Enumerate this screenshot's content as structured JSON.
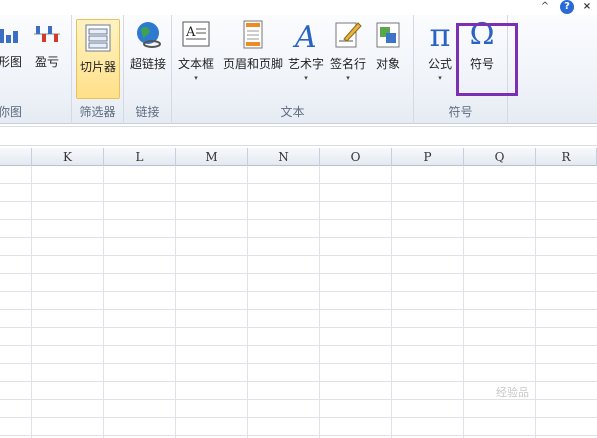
{
  "ribbon": {
    "groups": [
      {
        "label": "你图",
        "buttons": [
          {
            "label": "形图",
            "icon": "bar-sparkline-icon"
          },
          {
            "label": "盈亏",
            "icon": "winloss-sparkline-icon"
          }
        ]
      },
      {
        "label": "筛选器",
        "buttons": [
          {
            "label": "切片器",
            "icon": "slicer-icon"
          }
        ]
      },
      {
        "label": "链接",
        "buttons": [
          {
            "label": "超链接",
            "icon": "hyperlink-globe-icon"
          }
        ]
      },
      {
        "label": "文本",
        "buttons": [
          {
            "label": "文本框",
            "icon": "textbox-icon",
            "dropdown": "▾"
          },
          {
            "label": "页眉和页脚",
            "icon": "header-footer-icon"
          },
          {
            "label": "艺术字",
            "icon": "wordart-icon",
            "dropdown": "▾"
          },
          {
            "label": "签名行",
            "icon": "signature-line-icon",
            "dropdown": "▾"
          },
          {
            "label": "对象",
            "icon": "object-icon"
          }
        ]
      },
      {
        "label": "符号",
        "buttons": [
          {
            "label": "公式",
            "icon": "pi-equation-icon",
            "glyph": "π",
            "dropdown": "▾"
          },
          {
            "label": "符号",
            "icon": "omega-symbol-icon",
            "glyph": "Ω"
          }
        ]
      }
    ]
  },
  "window_controls": {
    "collapse": "^",
    "help": "?",
    "close": "×"
  },
  "columns": [
    "K",
    "L",
    "M",
    "N",
    "O",
    "P",
    "Q",
    "R"
  ],
  "watermark": "经验品"
}
